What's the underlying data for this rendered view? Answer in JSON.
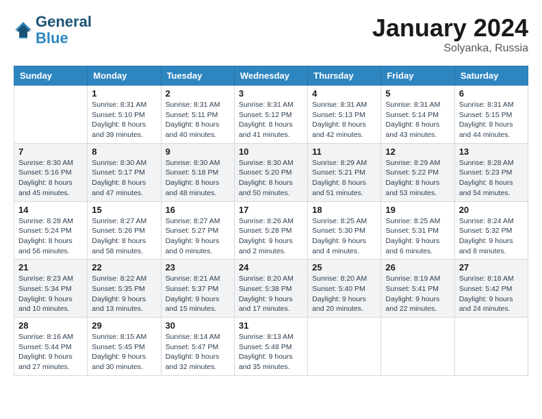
{
  "header": {
    "logo_line1": "General",
    "logo_line2": "Blue",
    "month_title": "January 2024",
    "location": "Solyanka, Russia"
  },
  "weekdays": [
    "Sunday",
    "Monday",
    "Tuesday",
    "Wednesday",
    "Thursday",
    "Friday",
    "Saturday"
  ],
  "weeks": [
    [
      {
        "day": "",
        "sunrise": "",
        "sunset": "",
        "daylight": ""
      },
      {
        "day": "1",
        "sunrise": "8:31 AM",
        "sunset": "5:10 PM",
        "daylight": "8 hours and 39 minutes."
      },
      {
        "day": "2",
        "sunrise": "8:31 AM",
        "sunset": "5:11 PM",
        "daylight": "8 hours and 40 minutes."
      },
      {
        "day": "3",
        "sunrise": "8:31 AM",
        "sunset": "5:12 PM",
        "daylight": "8 hours and 41 minutes."
      },
      {
        "day": "4",
        "sunrise": "8:31 AM",
        "sunset": "5:13 PM",
        "daylight": "8 hours and 42 minutes."
      },
      {
        "day": "5",
        "sunrise": "8:31 AM",
        "sunset": "5:14 PM",
        "daylight": "8 hours and 43 minutes."
      },
      {
        "day": "6",
        "sunrise": "8:31 AM",
        "sunset": "5:15 PM",
        "daylight": "8 hours and 44 minutes."
      }
    ],
    [
      {
        "day": "7",
        "sunrise": "8:30 AM",
        "sunset": "5:16 PM",
        "daylight": "8 hours and 45 minutes."
      },
      {
        "day": "8",
        "sunrise": "8:30 AM",
        "sunset": "5:17 PM",
        "daylight": "8 hours and 47 minutes."
      },
      {
        "day": "9",
        "sunrise": "8:30 AM",
        "sunset": "5:18 PM",
        "daylight": "8 hours and 48 minutes."
      },
      {
        "day": "10",
        "sunrise": "8:30 AM",
        "sunset": "5:20 PM",
        "daylight": "8 hours and 50 minutes."
      },
      {
        "day": "11",
        "sunrise": "8:29 AM",
        "sunset": "5:21 PM",
        "daylight": "8 hours and 51 minutes."
      },
      {
        "day": "12",
        "sunrise": "8:29 AM",
        "sunset": "5:22 PM",
        "daylight": "8 hours and 53 minutes."
      },
      {
        "day": "13",
        "sunrise": "8:28 AM",
        "sunset": "5:23 PM",
        "daylight": "8 hours and 54 minutes."
      }
    ],
    [
      {
        "day": "14",
        "sunrise": "8:28 AM",
        "sunset": "5:24 PM",
        "daylight": "8 hours and 56 minutes."
      },
      {
        "day": "15",
        "sunrise": "8:27 AM",
        "sunset": "5:26 PM",
        "daylight": "8 hours and 58 minutes."
      },
      {
        "day": "16",
        "sunrise": "8:27 AM",
        "sunset": "5:27 PM",
        "daylight": "9 hours and 0 minutes."
      },
      {
        "day": "17",
        "sunrise": "8:26 AM",
        "sunset": "5:28 PM",
        "daylight": "9 hours and 2 minutes."
      },
      {
        "day": "18",
        "sunrise": "8:25 AM",
        "sunset": "5:30 PM",
        "daylight": "9 hours and 4 minutes."
      },
      {
        "day": "19",
        "sunrise": "8:25 AM",
        "sunset": "5:31 PM",
        "daylight": "9 hours and 6 minutes."
      },
      {
        "day": "20",
        "sunrise": "8:24 AM",
        "sunset": "5:32 PM",
        "daylight": "9 hours and 8 minutes."
      }
    ],
    [
      {
        "day": "21",
        "sunrise": "8:23 AM",
        "sunset": "5:34 PM",
        "daylight": "9 hours and 10 minutes."
      },
      {
        "day": "22",
        "sunrise": "8:22 AM",
        "sunset": "5:35 PM",
        "daylight": "9 hours and 13 minutes."
      },
      {
        "day": "23",
        "sunrise": "8:21 AM",
        "sunset": "5:37 PM",
        "daylight": "9 hours and 15 minutes."
      },
      {
        "day": "24",
        "sunrise": "8:20 AM",
        "sunset": "5:38 PM",
        "daylight": "9 hours and 17 minutes."
      },
      {
        "day": "25",
        "sunrise": "8:20 AM",
        "sunset": "5:40 PM",
        "daylight": "9 hours and 20 minutes."
      },
      {
        "day": "26",
        "sunrise": "8:19 AM",
        "sunset": "5:41 PM",
        "daylight": "9 hours and 22 minutes."
      },
      {
        "day": "27",
        "sunrise": "8:18 AM",
        "sunset": "5:42 PM",
        "daylight": "9 hours and 24 minutes."
      }
    ],
    [
      {
        "day": "28",
        "sunrise": "8:16 AM",
        "sunset": "5:44 PM",
        "daylight": "9 hours and 27 minutes."
      },
      {
        "day": "29",
        "sunrise": "8:15 AM",
        "sunset": "5:45 PM",
        "daylight": "9 hours and 30 minutes."
      },
      {
        "day": "30",
        "sunrise": "8:14 AM",
        "sunset": "5:47 PM",
        "daylight": "9 hours and 32 minutes."
      },
      {
        "day": "31",
        "sunrise": "8:13 AM",
        "sunset": "5:48 PM",
        "daylight": "9 hours and 35 minutes."
      },
      {
        "day": "",
        "sunrise": "",
        "sunset": "",
        "daylight": ""
      },
      {
        "day": "",
        "sunrise": "",
        "sunset": "",
        "daylight": ""
      },
      {
        "day": "",
        "sunrise": "",
        "sunset": "",
        "daylight": ""
      }
    ]
  ],
  "labels": {
    "sunrise": "Sunrise:",
    "sunset": "Sunset:",
    "daylight": "Daylight:"
  }
}
